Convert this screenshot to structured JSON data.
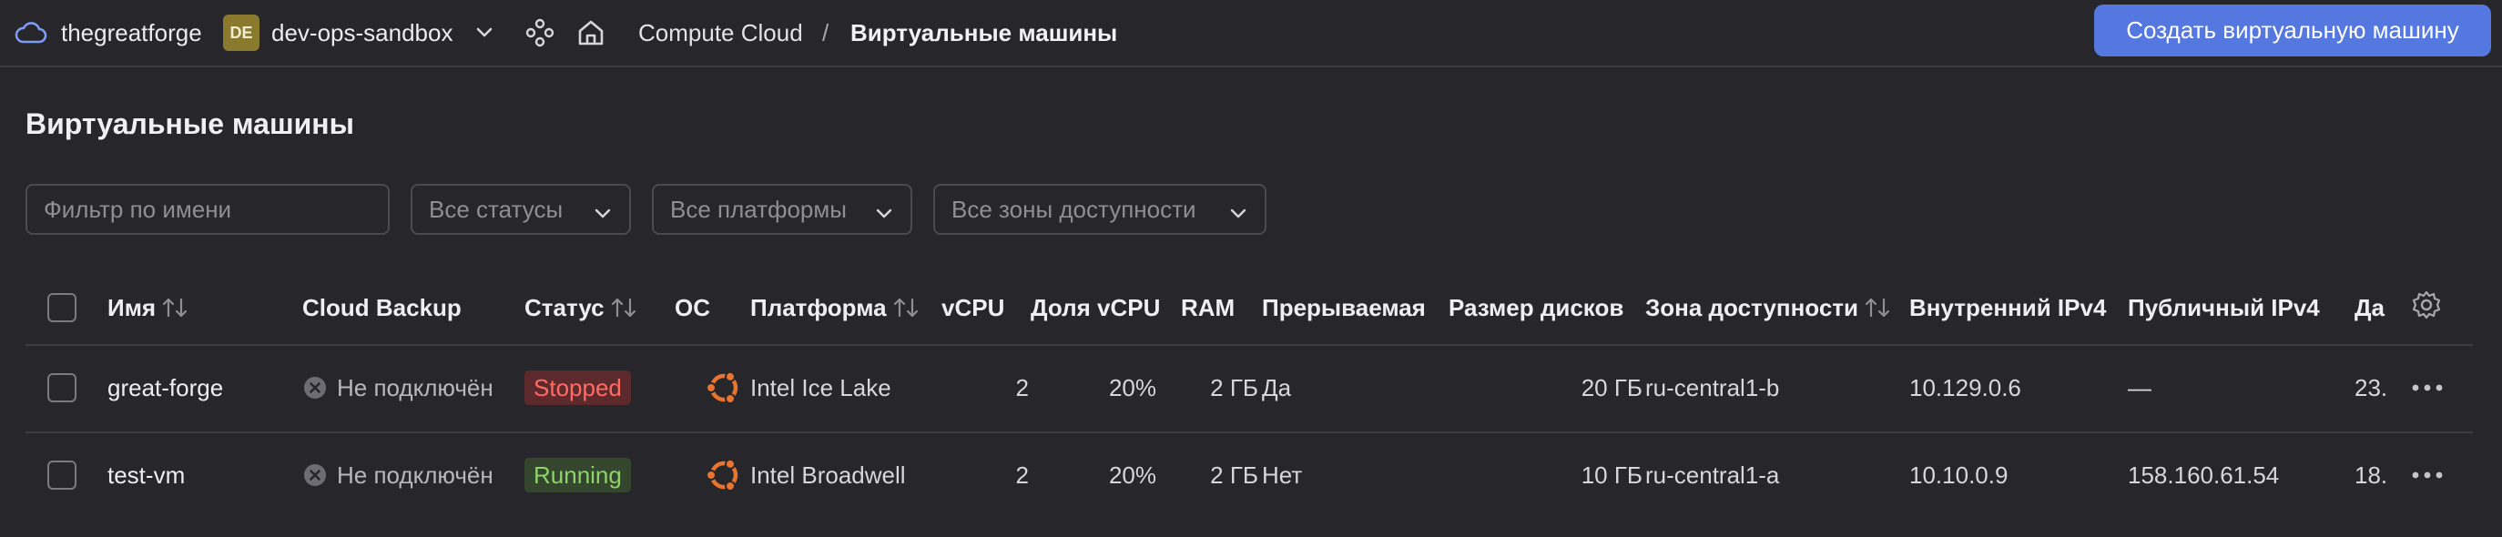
{
  "header": {
    "org_name": "thegreatforge",
    "folder_badge": "DE",
    "folder_name": "dev-ops-sandbox",
    "breadcrumb_service": "Compute Cloud",
    "breadcrumb_separator": "/",
    "breadcrumb_current": "Виртуальные машины",
    "create_button": "Создать виртуальную машину"
  },
  "page": {
    "title": "Виртуальные машины"
  },
  "filters": {
    "name_placeholder": "Фильтр по имени",
    "status": "Все статусы",
    "platform": "Все платформы",
    "zone": "Все зоны доступности"
  },
  "table": {
    "columns": {
      "name": "Имя",
      "backup": "Cloud Backup",
      "status": "Статус",
      "os": "ОС",
      "platform": "Платформа",
      "vcpu": "vCPU",
      "vcpu_share": "Доля vCPU",
      "ram": "RAM",
      "preemptible": "Прерываемая",
      "disk_size": "Размер дисков",
      "zone": "Зона доступности",
      "internal_ip": "Внутренний IPv4",
      "public_ip": "Публичный IPv4",
      "date": "Да"
    },
    "rows": [
      {
        "name": "great-forge",
        "backup": "Не подключён",
        "status": "Stopped",
        "os_icon": "ubuntu-icon",
        "platform": "Intel Ice Lake",
        "vcpu": "2",
        "vcpu_share": "20%",
        "ram": "2 ГБ",
        "preemptible": "Да",
        "disk_size": "20 ГБ",
        "zone": "ru-central1-b",
        "internal_ip": "10.129.0.6",
        "public_ip": "—",
        "date": "23."
      },
      {
        "name": "test-vm",
        "backup": "Не подключён",
        "status": "Running",
        "os_icon": "ubuntu-icon",
        "platform": "Intel Broadwell",
        "vcpu": "2",
        "vcpu_share": "20%",
        "ram": "2 ГБ",
        "preemptible": "Нет",
        "disk_size": "10 ГБ",
        "zone": "ru-central1-a",
        "internal_ip": "10.10.0.9",
        "public_ip": "158.160.61.54",
        "date": "18."
      }
    ]
  },
  "colors": {
    "background": "#27262b",
    "accent": "#5577e0",
    "stopped": "#ff6b63",
    "running": "#8fd16a",
    "ubuntu": "#e8742f",
    "folder_badge": "#8a7a2e"
  }
}
